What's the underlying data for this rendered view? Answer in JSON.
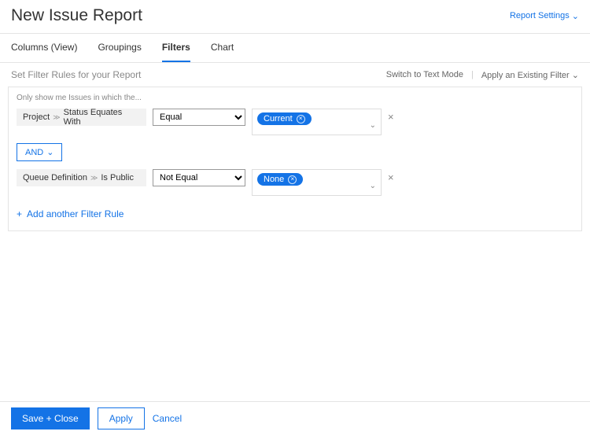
{
  "header": {
    "title": "New Issue Report",
    "settings": "Report Settings"
  },
  "tabs": {
    "columns": "Columns (View)",
    "groupings": "Groupings",
    "filters": "Filters",
    "chart": "Chart"
  },
  "subheader": {
    "title": "Set Filter Rules for your Report",
    "switch_mode": "Switch to Text Mode",
    "apply_existing": "Apply an Existing Filter"
  },
  "panel": {
    "helper": "Only show me Issues in which the...",
    "rules": [
      {
        "field_parent": "Project",
        "field_child": "Status Equates With",
        "operator": "Equal",
        "value": "Current"
      },
      {
        "field_parent": "Queue Definition",
        "field_child": "Is Public",
        "operator": "Not Equal",
        "value": "None"
      }
    ],
    "logic": "AND",
    "add_rule": "Add another Filter Rule"
  },
  "footer": {
    "save": "Save + Close",
    "apply": "Apply",
    "cancel": "Cancel"
  }
}
